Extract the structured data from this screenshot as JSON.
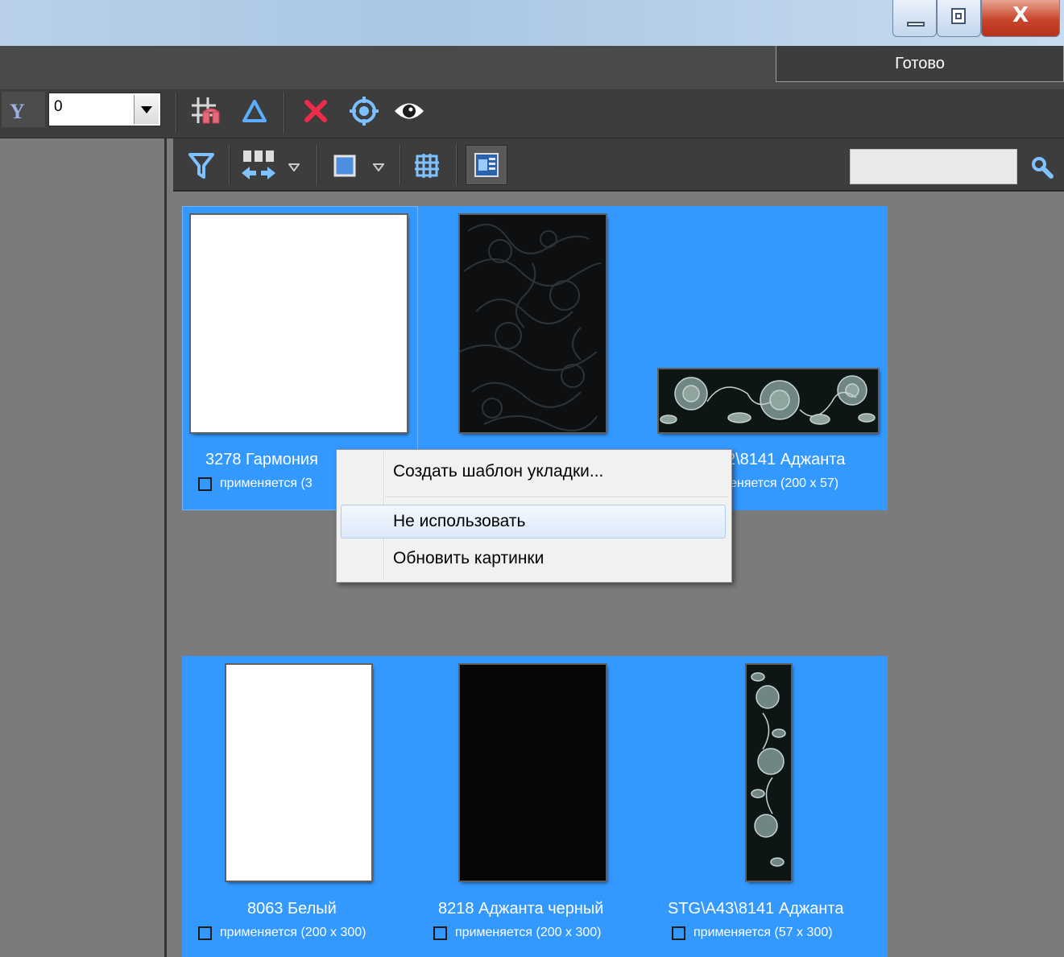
{
  "window": {
    "controls": {
      "minimize_icon": "minimize-icon",
      "maximize_icon": "restore-icon",
      "close_label": "X"
    },
    "done_button": "Готово"
  },
  "toolbar1": {
    "axis_label": "Y",
    "axis_value": "0",
    "icons": [
      "snap-grid-icon",
      "triangle-icon",
      "delete-x-icon",
      "target-icon",
      "eye-icon"
    ]
  },
  "toolbar2": {
    "icons": [
      "filter-icon",
      "arrange-icon",
      "dropdown-arrow-icon",
      "square-view-icon",
      "dropdown-arrow-icon",
      "grid-icon",
      "panel-icon"
    ],
    "search_placeholder": "",
    "search_icon": "magnifier-icon"
  },
  "tiles": [
    {
      "name": "3278 Гармония",
      "status": "применяется (3",
      "thumb": "white"
    },
    {
      "name": "",
      "status": "",
      "thumb": "black-floral"
    },
    {
      "name": "2\\8141 Аджанта",
      "status": "еняется (200 x 57)",
      "thumb": "floral-strip"
    },
    {
      "name": "8063 Белый",
      "status": "применяется (200 x 300)",
      "thumb": "white"
    },
    {
      "name": "8218 Аджанта черный",
      "status": "применяется (200 x 300)",
      "thumb": "black"
    },
    {
      "name": "STG\\A43\\8141 Аджанта",
      "status": "применяется (57 x 300)",
      "thumb": "floral-vertical"
    }
  ],
  "context_menu": {
    "items": [
      "Создать шаблон укладки...",
      "Не использовать",
      "Обновить картинки"
    ],
    "highlighted_index": 1
  },
  "colors": {
    "selection": "#3399ff",
    "panel": "#7b7b7b",
    "toolbar": "#3d3d3d"
  }
}
